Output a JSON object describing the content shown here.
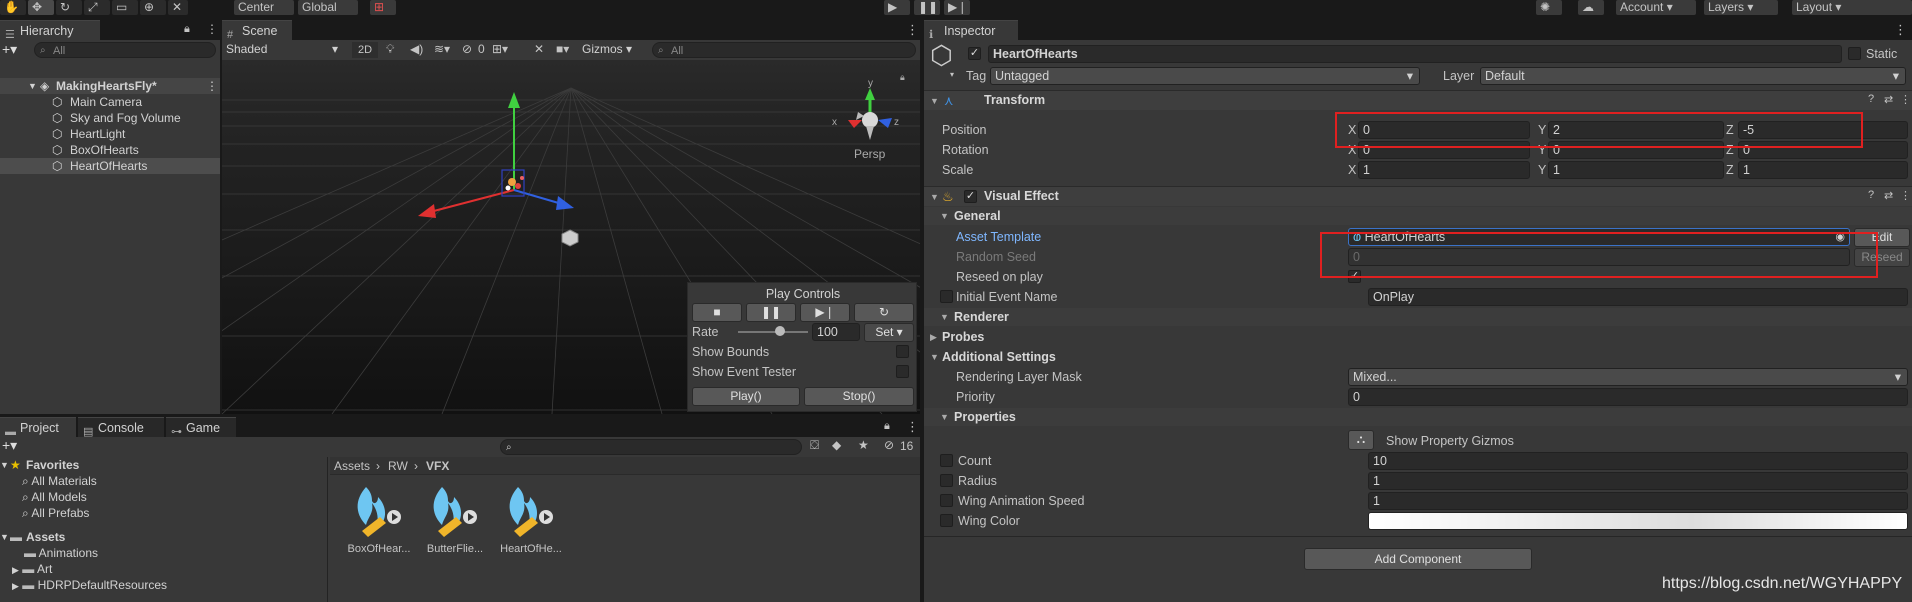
{
  "toolbar": {
    "pivot": "Center",
    "space": "Global",
    "account": "Account",
    "layers": "Layers",
    "layout": "Layout"
  },
  "hierarchy": {
    "tab": "Hierarchy",
    "search_placeholder": "All",
    "scene": "MakingHeartsFly*",
    "items": [
      "Main Camera",
      "Sky and Fog Volume",
      "HeartLight",
      "BoxOfHearts",
      "HeartOfHearts"
    ]
  },
  "scene_view": {
    "tab": "Scene",
    "draw_mode": "Shaded",
    "mode_2d": "2D",
    "hidden_count": "0",
    "gizmos": "Gizmos",
    "search_placeholder": "All",
    "persp": "Persp",
    "axis_x": "x",
    "axis_y": "y",
    "axis_z": "z"
  },
  "play_controls": {
    "title": "Play Controls",
    "rate_label": "Rate",
    "rate_value": "100",
    "set_label": "Set",
    "show_bounds": "Show Bounds",
    "show_event_tester": "Show Event Tester",
    "play_btn": "Play()",
    "stop_btn": "Stop()",
    "rate_fraction": 0.6
  },
  "project": {
    "tabs": [
      "Project",
      "Console",
      "Game"
    ],
    "favorites": "Favorites",
    "favorite_items": [
      "All Materials",
      "All Models",
      "All Prefabs"
    ],
    "assets": "Assets",
    "asset_folders": [
      "Animations",
      "Art",
      "HDRPDefaultResources"
    ],
    "hidden_count": "16",
    "breadcrumb": [
      "Assets",
      "RW",
      "VFX"
    ],
    "files": [
      "BoxOfHear...",
      "ButterFlie...",
      "HeartOfHe..."
    ]
  },
  "inspector": {
    "tab": "Inspector",
    "object_name": "HeartOfHearts",
    "static_label": "Static",
    "tag_label": "Tag",
    "tag_value": "Untagged",
    "layer_label": "Layer",
    "layer_value": "Default",
    "transform": {
      "title": "Transform",
      "position_label": "Position",
      "rotation_label": "Rotation",
      "scale_label": "Scale",
      "position": [
        "0",
        "2",
        "-5"
      ],
      "rotation": [
        "0",
        "0",
        "0"
      ],
      "scale": [
        "1",
        "1",
        "1"
      ],
      "axes": [
        "X",
        "Y",
        "Z"
      ]
    },
    "visual_effect": {
      "title": "Visual Effect",
      "general": "General",
      "asset_template_label": "Asset Template",
      "asset_template_value": "HeartOfHearts",
      "edit_btn": "Edit",
      "random_seed_label": "Random Seed",
      "random_seed_value": "0",
      "reseed_btn": "Reseed",
      "reseed_on_play_label": "Reseed on play",
      "initial_event_label": "Initial Event Name",
      "initial_event_value": "OnPlay",
      "renderer": "Renderer",
      "probes": "Probes",
      "additional_settings": "Additional Settings",
      "rendering_layer_mask_label": "Rendering Layer Mask",
      "rendering_layer_mask_value": "Mixed...",
      "priority_label": "Priority",
      "priority_value": "0",
      "properties": "Properties",
      "show_gizmos": "Show Property Gizmos",
      "props": [
        {
          "label": "Count",
          "value": "10"
        },
        {
          "label": "Radius",
          "value": "1"
        },
        {
          "label": "Wing Animation Speed",
          "value": "1"
        },
        {
          "label": "Wing Color",
          "value": ""
        }
      ]
    },
    "add_component": "Add Component"
  },
  "watermark": "https://blog.csdn.net/WGYHAPPY",
  "colors": {
    "link": "#7fb7ff",
    "highlight": "#e02020"
  }
}
